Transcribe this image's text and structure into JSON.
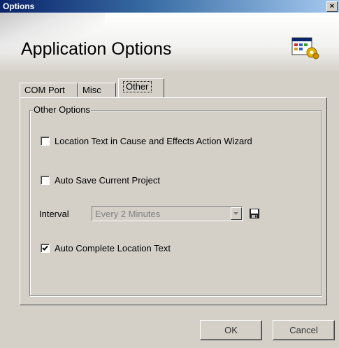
{
  "window": {
    "title": "Options",
    "close_glyph": "×"
  },
  "header": {
    "heading": "Application Options",
    "icon": "settings-gear-icon"
  },
  "tabs": [
    {
      "label": "COM Port",
      "active": false
    },
    {
      "label": "Misc",
      "active": false
    },
    {
      "label": "Other",
      "active": true
    }
  ],
  "group": {
    "legend": "Other Options",
    "location_text_wizard": {
      "label": "Location Text in Cause and Effects Action Wizard",
      "checked": false
    },
    "auto_save": {
      "label": "Auto Save Current Project",
      "checked": false
    },
    "interval": {
      "label": "Interval",
      "value": "Every 2 Minutes",
      "enabled": false
    },
    "auto_complete": {
      "label": "Auto Complete Location Text",
      "checked": true
    }
  },
  "buttons": {
    "ok": "OK",
    "cancel": "Cancel"
  }
}
